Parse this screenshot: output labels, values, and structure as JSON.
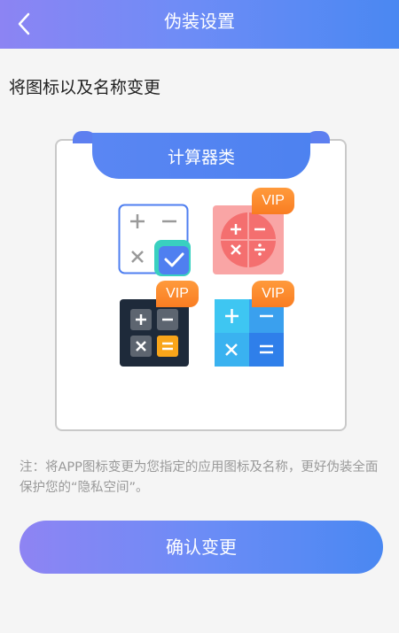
{
  "header": {
    "title": "伪装设置"
  },
  "section_label": "将图标以及名称变更",
  "card": {
    "tab_label": "计算器类",
    "options": [
      {
        "name": "calculator-style-1",
        "selected": true,
        "vip": false
      },
      {
        "name": "calculator-style-2",
        "selected": false,
        "vip": true,
        "vip_label": "VIP"
      },
      {
        "name": "calculator-style-3",
        "selected": false,
        "vip": true,
        "vip_label": "VIP"
      },
      {
        "name": "calculator-style-4",
        "selected": false,
        "vip": true,
        "vip_label": "VIP"
      }
    ]
  },
  "note": "注：将APP图标变更为您指定的应用图标及名称，更好伪装全面保护您的“隐私空间”。",
  "confirm_button": "确认变更",
  "colors": {
    "accent_start": "#8c84f3",
    "accent_end": "#4a88f2",
    "vip_orange": "#f97d22"
  }
}
